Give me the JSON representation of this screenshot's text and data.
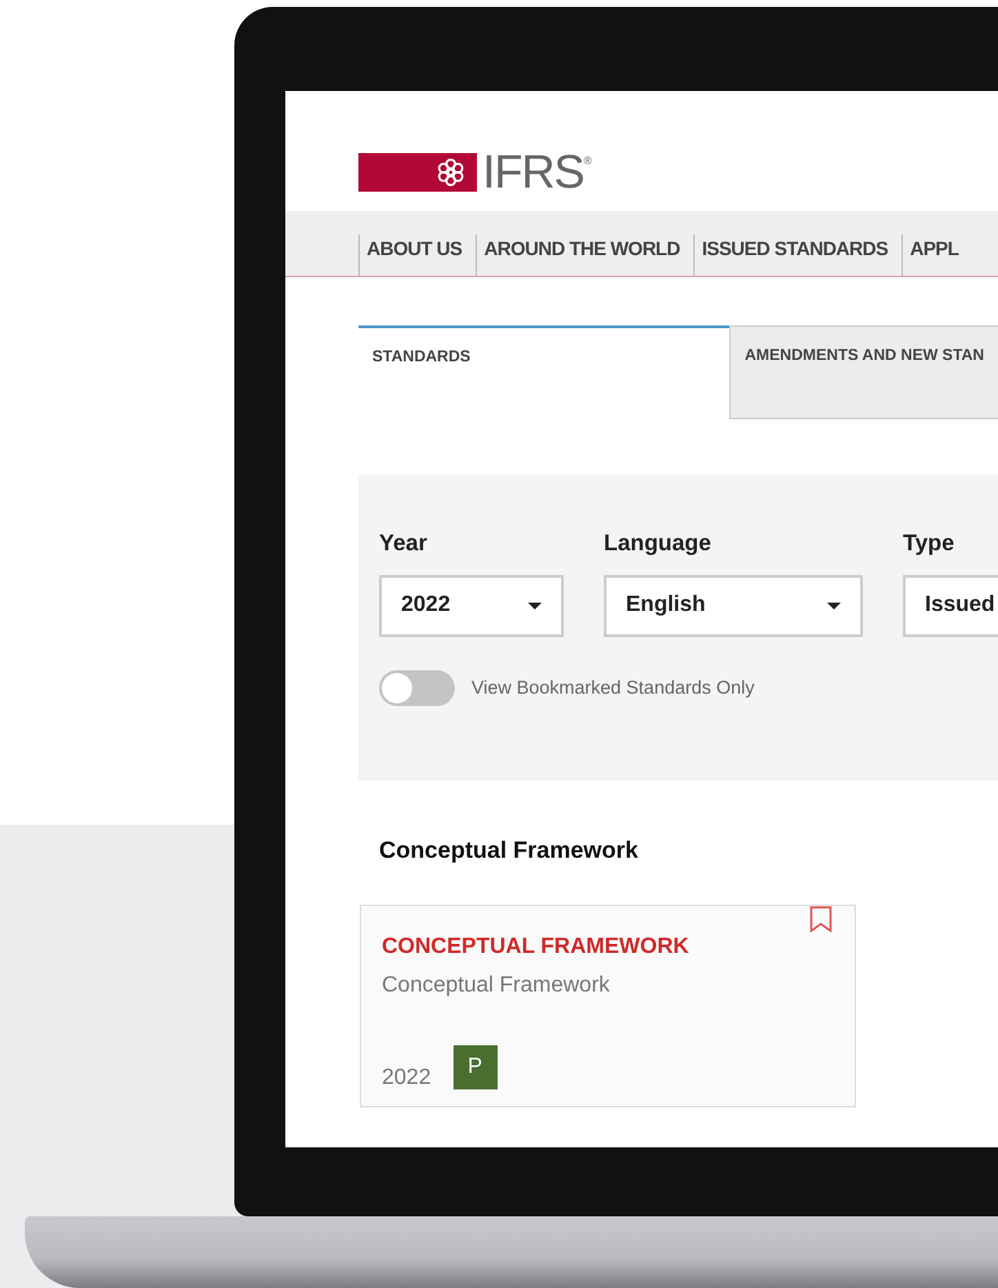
{
  "logo": {
    "text": "IFRS",
    "mark": "®"
  },
  "nav": [
    {
      "label": "ABOUT US"
    },
    {
      "label": "AROUND THE WORLD"
    },
    {
      "label": "ISSUED STANDARDS"
    },
    {
      "label": "APPL"
    }
  ],
  "tabs": [
    {
      "label": "STANDARDS",
      "selected": true
    },
    {
      "label": "AMENDMENTS AND NEW STAN",
      "selected": false
    }
  ],
  "filters": {
    "fields": [
      {
        "label": "Year",
        "value": "2022",
        "kind": "dropdown"
      },
      {
        "label": "Language",
        "value": "English",
        "kind": "dropdown"
      },
      {
        "label": "Type",
        "value": "Issued",
        "kind": "field"
      }
    ],
    "toggle": {
      "label": "View Bookmarked Standards Only",
      "on": false
    }
  },
  "section": {
    "heading": "Conceptual Framework",
    "cards": [
      {
        "title": "CONCEPTUAL FRAMEWORK",
        "subtitle": "Conceptual Framework",
        "year": "2022",
        "badge": "P",
        "bookmarked": false
      }
    ]
  }
}
